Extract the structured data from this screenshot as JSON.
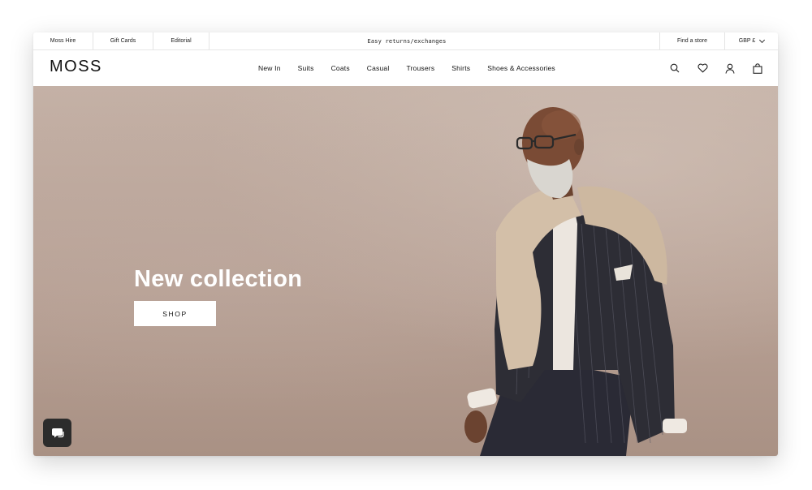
{
  "utility_bar": {
    "left_links": [
      "Moss Hire",
      "Gift Cards",
      "Editorial"
    ],
    "promo_text": "Easy returns/exchanges",
    "find_store": "Find a store",
    "currency": "GBP £"
  },
  "header": {
    "logo": "MOSS",
    "nav": [
      "New In",
      "Suits",
      "Coats",
      "Casual",
      "Trousers",
      "Shirts",
      "Shoes & Accessories"
    ],
    "icons": [
      "search-icon",
      "heart-icon",
      "account-icon",
      "bag-icon"
    ]
  },
  "hero": {
    "title": "New collection",
    "cta": "SHOP"
  },
  "chat": {
    "icon": "chat-icon"
  },
  "colors": {
    "hero_background": "#b8a195",
    "chat_button": "#2c2c2c",
    "text": "#111111"
  }
}
